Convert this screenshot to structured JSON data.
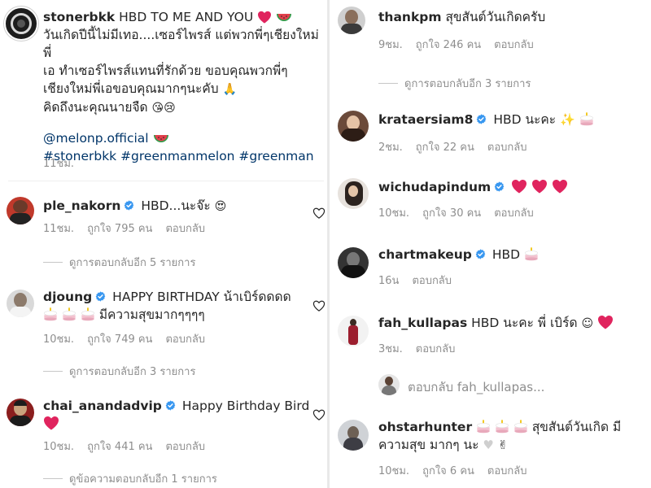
{
  "post": {
    "username": "stonerbkk",
    "caption_line1": "HBD TO ME AND YOU",
    "caption_line2": "วันเกิดปีนี้ไม่มีเทอ....เซอร์ไพรส์ แต่พวกพี่ๆเชียงใหม่พี่",
    "caption_line3": "เอ ทำเซอร์ไพรส์แทนที่รักด้วย ขอบคุณพวกพี่ๆ",
    "caption_line4": "เชียงใหม่พี่เอขอบคุณมากๆนะคับ",
    "caption_line5": "คิดถึงนะคุณนายจืด",
    "mention": "@melonp.official",
    "hashtags": "#stonerbkk #greenmanmelon #greenman",
    "time": "11ชม."
  },
  "left_comments": [
    {
      "username": "ple_nakorn",
      "text": "HBD...นะจ๊ะ",
      "time": "11ชม.",
      "likes": "ถูกใจ 795 คน",
      "reply": "ตอบกลับ",
      "more": "ดูการตอบกลับอีก 5 รายการ"
    },
    {
      "username": "djoung",
      "text_line1": "HAPPY BIRTHDAY น้าเบิร์ดดดด",
      "text_line2": "มีความสุขมากๆๆๆๆ",
      "time": "10ชม.",
      "likes": "ถูกใจ 749 คน",
      "reply": "ตอบกลับ",
      "more": "ดูการตอบกลับอีก 3 รายการ"
    },
    {
      "username": "chai_anandadvip",
      "text": "Happy Birthday Bird",
      "time": "10ชม.",
      "likes": "ถูกใจ 441 คน",
      "reply": "ตอบกลับ",
      "more": "ดูข้อความตอบกลับอีก 1 รายการ"
    }
  ],
  "right_comments": [
    {
      "username": "thankpm",
      "text": "สุขสันต์วันเกิดครับ",
      "time": "9ชม.",
      "likes": "ถูกใจ 246 คน",
      "reply": "ตอบกลับ",
      "more": "ดูการตอบกลับอีก 3 รายการ"
    },
    {
      "username": "krataersiam8",
      "text": "HBD นะคะ",
      "time": "2ชม.",
      "likes": "ถูกใจ 22 คน",
      "reply": "ตอบกลับ"
    },
    {
      "username": "wichudapindum",
      "text": "",
      "time": "10ชม.",
      "likes": "ถูกใจ 30 คน",
      "reply": "ตอบกลับ"
    },
    {
      "username": "chartmakeup",
      "text": "HBD",
      "time": "16น",
      "reply": "ตอบกลับ"
    },
    {
      "username": "fah_kullapas",
      "text": "HBD นะคะ พี่ เบิร์ด",
      "time": "3ชม.",
      "reply": "ตอบกลับ"
    },
    {
      "reply_preview": "ตอบกลับ fah_kullapas..."
    },
    {
      "username": "ohstarhunter",
      "text_line1": "สุขสันต์วันเกิด มี",
      "text_line2": "ความสุข มากๆ นะ",
      "time": "10ชม.",
      "likes": "ถูกใจ 6 คน",
      "reply": "ตอบกลับ"
    }
  ],
  "colors": {
    "heart_red": "#e0245e",
    "link_blue": "#003569",
    "verified_blue": "#3897f0",
    "meta_gray": "#8e8e8e"
  },
  "icons": [
    "heart-outline-icon",
    "verified-badge-icon",
    "heart-emoji-icon",
    "cake-emoji-icon",
    "watermelon-emoji-icon"
  ]
}
